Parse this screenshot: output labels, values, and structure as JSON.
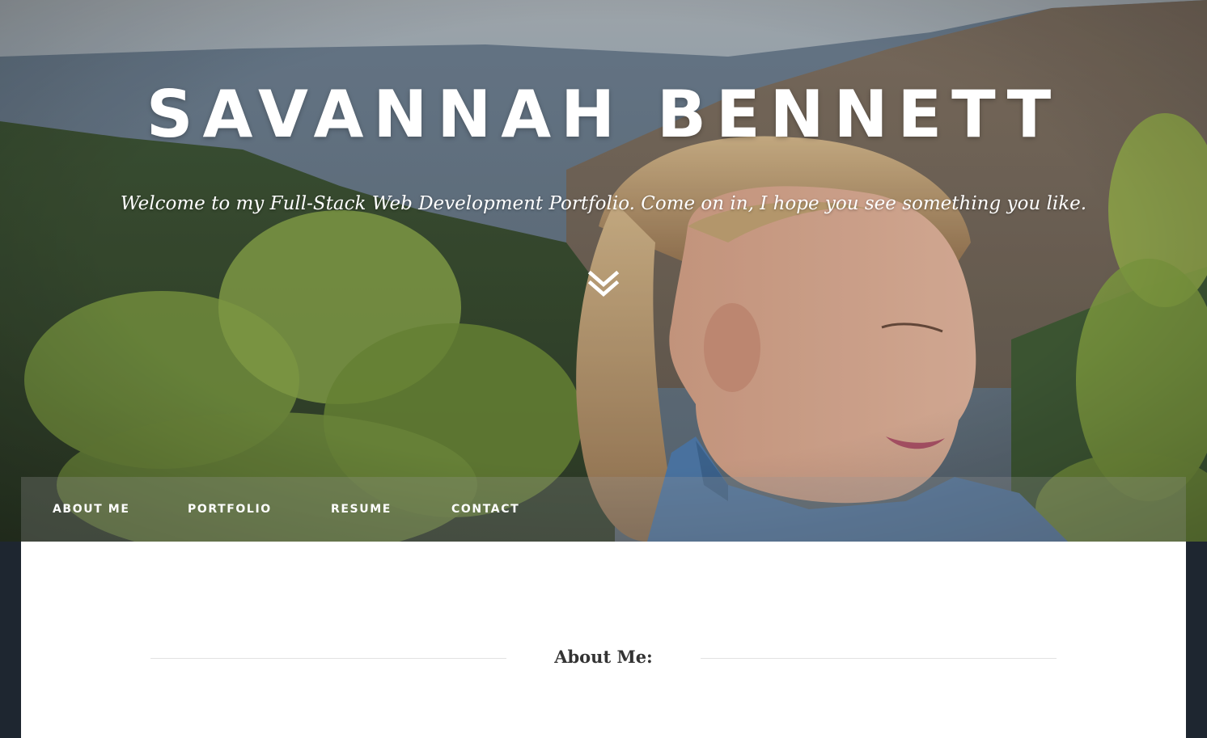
{
  "hero": {
    "title": "SAVANNAH BENNETT",
    "subtitle": "Welcome to my Full-Stack Web Development Portfolio. Come on in, I hope you see something you like.",
    "scroll_icon": "chevron-double-down-icon"
  },
  "nav": {
    "items": [
      {
        "label": "ABOUT ME"
      },
      {
        "label": "PORTFOLIO"
      },
      {
        "label": "RESUME"
      },
      {
        "label": "CONTACT"
      }
    ]
  },
  "about": {
    "heading": "About Me:"
  },
  "colors": {
    "page_background": "#1e2630",
    "panel_background": "#ffffff",
    "nav_overlay": "rgba(150,150,150,0.28)",
    "text_light": "#ffffff",
    "heading_text": "#333333",
    "divider": "#e2e2e2"
  }
}
